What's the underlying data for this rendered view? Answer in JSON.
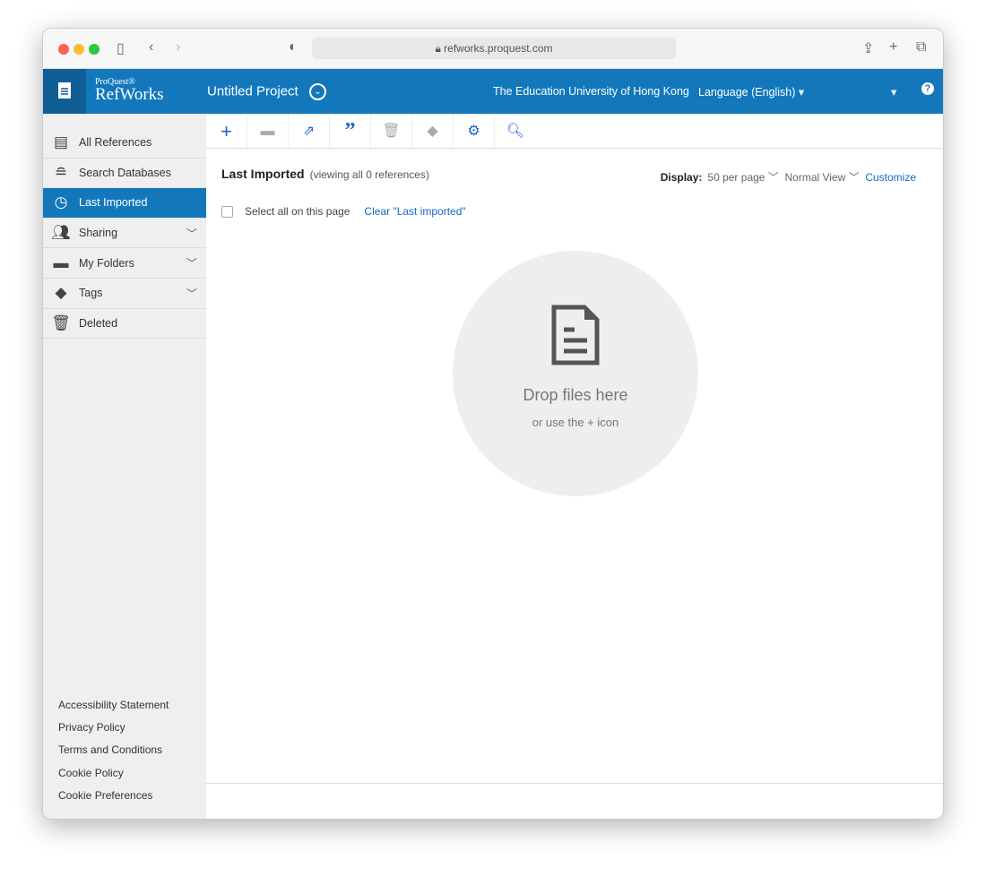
{
  "browser": {
    "url": "refworks.proquest.com"
  },
  "header": {
    "brand_small": "ProQuest®",
    "brand": "RefWorks",
    "project": "Untitled Project",
    "institution": "The Education University of Hong Kong",
    "language": "Language (English)"
  },
  "sidebar": {
    "items": [
      {
        "label": "All References",
        "icon": "document-icon"
      },
      {
        "label": "Search Databases",
        "icon": "database-icon"
      },
      {
        "label": "Last Imported",
        "icon": "clock-icon"
      },
      {
        "label": "Sharing",
        "icon": "users-icon"
      },
      {
        "label": "My Folders",
        "icon": "folder-icon"
      },
      {
        "label": "Tags",
        "icon": "tag-icon"
      },
      {
        "label": "Deleted",
        "icon": "trash-icon"
      }
    ],
    "footer": [
      "Accessibility Statement",
      "Privacy Policy",
      "Terms and Conditions",
      "Cookie Policy",
      "Cookie Preferences"
    ]
  },
  "main": {
    "title": "Last Imported",
    "subtitle": "(viewing all 0 references)",
    "display_label": "Display:",
    "per_page": "50 per page",
    "view": "Normal View",
    "customize": "Customize",
    "select_all": "Select all on this page",
    "clear": "Clear \"Last imported\"",
    "drop_title": "Drop files here",
    "drop_sub": "or use the + icon"
  },
  "colors": {
    "header": "#1378bb",
    "accent": "#1866c7"
  }
}
